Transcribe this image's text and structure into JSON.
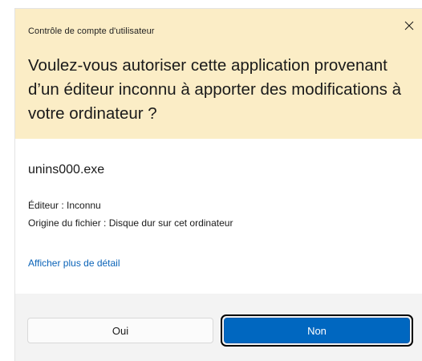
{
  "header": {
    "title": "Contrôle de compte d'utilisateur",
    "question": "Voulez-vous autoriser cette application provenant d’un éditeur inconnu à apporter des modifications à votre ordinateur ?",
    "close_icon": "close-icon"
  },
  "body": {
    "app_name": "unins000.exe",
    "publisher": "Éditeur : Inconnu",
    "origin": "Origine du fichier : Disque dur sur cet ordinateur",
    "details_link": "Afficher plus de détail"
  },
  "footer": {
    "yes_label": "Oui",
    "no_label": "Non"
  },
  "colors": {
    "header_bg": "#fbedc6",
    "accent": "#0067c0",
    "link": "#0a63b8",
    "footer_bg": "#f3f3f3"
  }
}
